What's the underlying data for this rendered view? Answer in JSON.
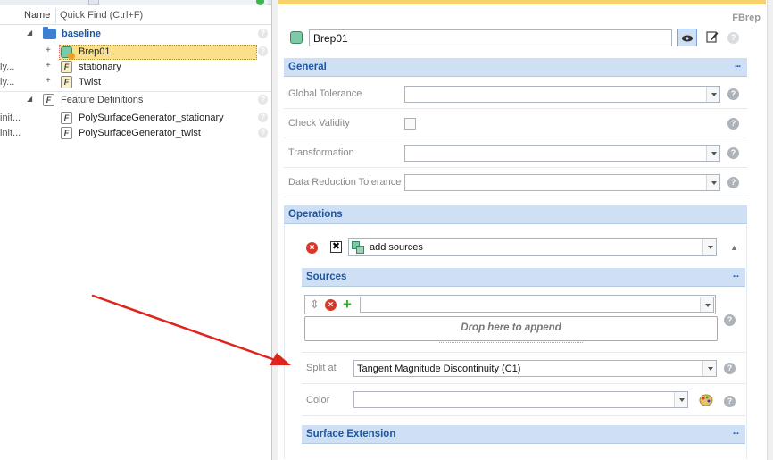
{
  "tree": {
    "header": {
      "name_col": "Name",
      "quick_find": "Quick Find (Ctrl+F)"
    },
    "rows": [
      {
        "label": "baseline",
        "clip": "",
        "expander": "◢"
      },
      {
        "label": "Brep01",
        "clip": "",
        "expander": "+"
      },
      {
        "label": "stationary",
        "clip": "ly...",
        "expander": "+"
      },
      {
        "label": "Twist",
        "clip": "ly...",
        "expander": "+"
      },
      {
        "label": "Feature Definitions",
        "clip": "",
        "expander": "◢"
      },
      {
        "label": "PolySurfaceGenerator_stationary",
        "clip": "init...",
        "expander": ""
      },
      {
        "label": "PolySurfaceGenerator_twist",
        "clip": "init...",
        "expander": ""
      }
    ],
    "fglyph": "F",
    "help_glyph": "?"
  },
  "props": {
    "type_label": "FBrep",
    "name_value": "Brep01",
    "more": "...",
    "help_glyph": "?",
    "general": {
      "title": "General",
      "global_tolerance": "Global Tolerance",
      "check_validity": "Check Validity",
      "transformation": "Transformation",
      "data_reduction_tolerance": "Data Reduction Tolerance"
    },
    "operations": {
      "title": "Operations",
      "operation_value": "add sources",
      "collapse": "▲",
      "remove_glyph": "×",
      "delete_glyph": "✖"
    },
    "sources": {
      "title": "Sources",
      "add_glyph": "+",
      "sort_glyph": "⇕",
      "drop_hint": "Drop here to append",
      "split_at_label": "Split at",
      "split_at_value": "Tangent Magnitude Discontinuity (C1)",
      "color_label": "Color"
    },
    "surface_extension": {
      "title": "Surface Extension"
    }
  },
  "colors": {
    "section_bg": "#cfe0f4",
    "section_text": "#1f56a1",
    "selection": "#fbe08a",
    "arrow": "#e0231b"
  }
}
